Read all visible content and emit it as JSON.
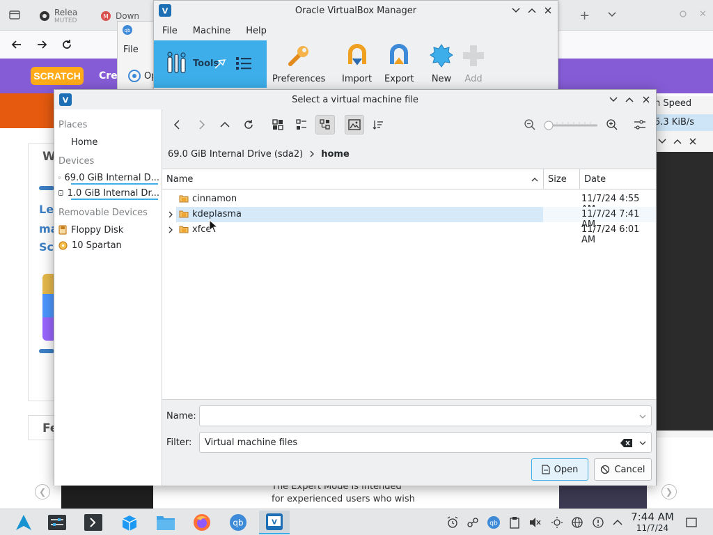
{
  "browser": {
    "tab1_title": "Relea",
    "tab1_sub": "MUTED",
    "tab2_title": "Down",
    "scratch_logo": "SCRATCH",
    "header_link": "Cre",
    "card_letters": [
      "W",
      "Le",
      "ma",
      "Sc"
    ],
    "card_bottom": "Fe",
    "bottom_text_1": "The Expert Mode is intended",
    "bottom_text_2": "for experienced users who wish"
  },
  "qbit": {
    "menu_file": "File",
    "left_label": "Op",
    "speed_header": "n Speed",
    "speed_value": "5.3 KiB/s"
  },
  "vbox": {
    "title": "Oracle VirtualBox Manager",
    "menu": [
      "File",
      "Machine",
      "Help"
    ],
    "tools_label": "Tools",
    "buttons": {
      "preferences": "Preferences",
      "import": "Import",
      "export": "Export",
      "new": "New",
      "add": "Add"
    }
  },
  "dialog": {
    "title": "Select a virtual machine file",
    "sidebar": {
      "places_heading": "Places",
      "home": "Home",
      "devices_heading": "Devices",
      "device1": "69.0 GiB Internal D...",
      "device2": "1.0 GiB Internal Dr...",
      "removable_heading": "Removable Devices",
      "floppy": "Floppy Disk",
      "spartan": "10 Spartan"
    },
    "breadcrumb": {
      "drive": "69.0 GiB Internal Drive (sda2)",
      "current": "home"
    },
    "columns": {
      "name": "Name",
      "size": "Size",
      "date": "Date"
    },
    "files": [
      {
        "name": "cinnamon",
        "date": "11/7/24 4:55 AM"
      },
      {
        "name": "kdeplasma",
        "date": "11/7/24 7:41 AM"
      },
      {
        "name": "xfce",
        "date": "11/7/24 6:01 AM"
      }
    ],
    "name_label": "Name:",
    "name_value": "",
    "filter_label": "Filter:",
    "filter_value": "Virtual machine files",
    "open_label": "Open",
    "cancel_label": "Cancel"
  },
  "taskbar": {
    "time": "7:44 AM",
    "date": "11/7/24"
  },
  "colors": {
    "accent": "#3daee9",
    "selection": "#d6e9f8",
    "scratch_purple": "#855cd6",
    "folder": "#f0a72f"
  }
}
